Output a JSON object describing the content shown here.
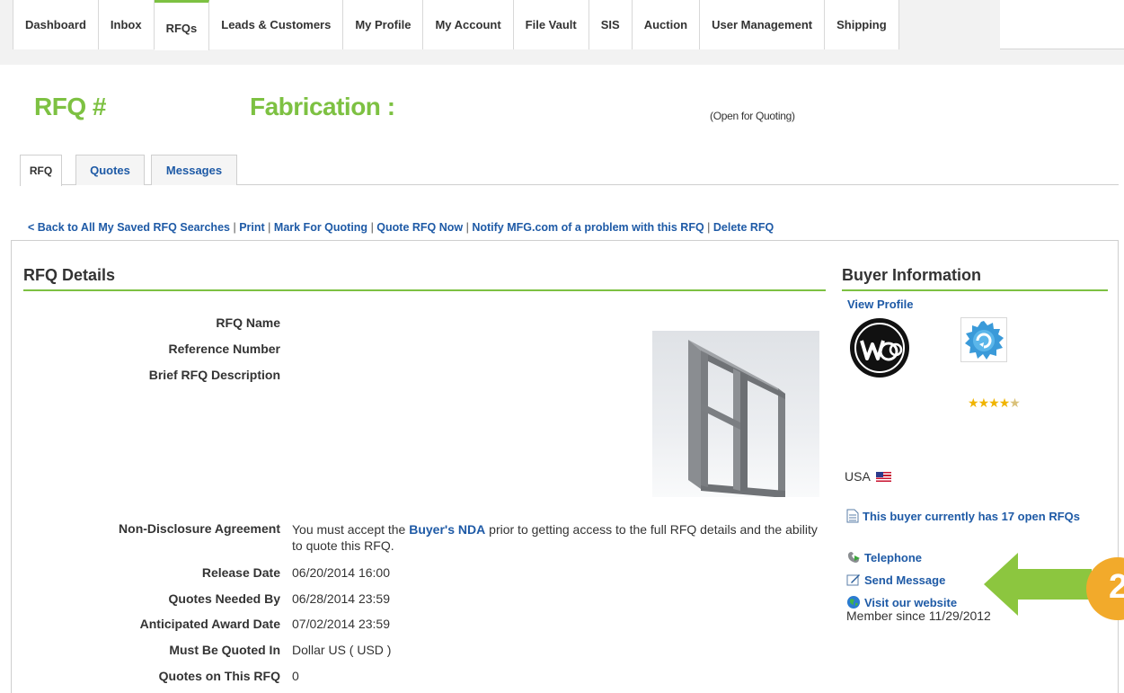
{
  "topnav": {
    "tabs": [
      "Dashboard",
      "Inbox",
      "RFQs",
      "Leads & Customers",
      "My Profile",
      "My Account",
      "File Vault",
      "SIS",
      "Auction",
      "User Management",
      "Shipping"
    ],
    "active_tab": "RFQs"
  },
  "header": {
    "rfq_label": "RFQ #",
    "category": "Fabrication :",
    "status": "(Open for Quoting)"
  },
  "subtabs": [
    "RFQ",
    "Quotes",
    "Messages"
  ],
  "actions": {
    "back": "< Back to All My Saved RFQ Searches",
    "print": "Print",
    "mark": "Mark For Quoting",
    "quote_now": "Quote RFQ Now",
    "notify": "Notify MFG.com of a problem with this RFQ",
    "delete": "Delete RFQ"
  },
  "details": {
    "heading": "RFQ Details",
    "rfq_name_label": "RFQ Name",
    "reference_label": "Reference Number",
    "brief_label": "Brief RFQ Description",
    "nda_label": "Non-Disclosure Agreement",
    "nda_pre": "You must accept the ",
    "nda_link": "Buyer's NDA",
    "nda_post": " prior to getting access to the full RFQ details and the ability to quote this RFQ.",
    "release_label": "Release Date",
    "release_value": "06/20/2014 16:00",
    "needed_label": "Quotes Needed By",
    "needed_value": "06/28/2014 23:59",
    "award_label": "Anticipated Award Date",
    "award_value": "07/02/2014 23:59",
    "currency_label": "Must Be Quoted In",
    "currency_value": "Dollar US ( USD )",
    "quotes_label": "Quotes on This RFQ",
    "quotes_value": "0"
  },
  "buyer": {
    "heading": "Buyer Information",
    "view_profile": "View Profile",
    "rating": 4.5,
    "country": "USA",
    "open_rfqs": "This buyer currently has 17 open RFQs",
    "telephone": "Telephone",
    "send_message": "Send Message",
    "website": "Visit our website",
    "member_since": "Member since 11/29/2012"
  },
  "callout": {
    "number": "2",
    "colors": {
      "arrow": "#8cc63f",
      "circle": "#f2aa2b"
    }
  },
  "colors": {
    "accent": "#7dc142",
    "link": "#1e5aa6"
  }
}
